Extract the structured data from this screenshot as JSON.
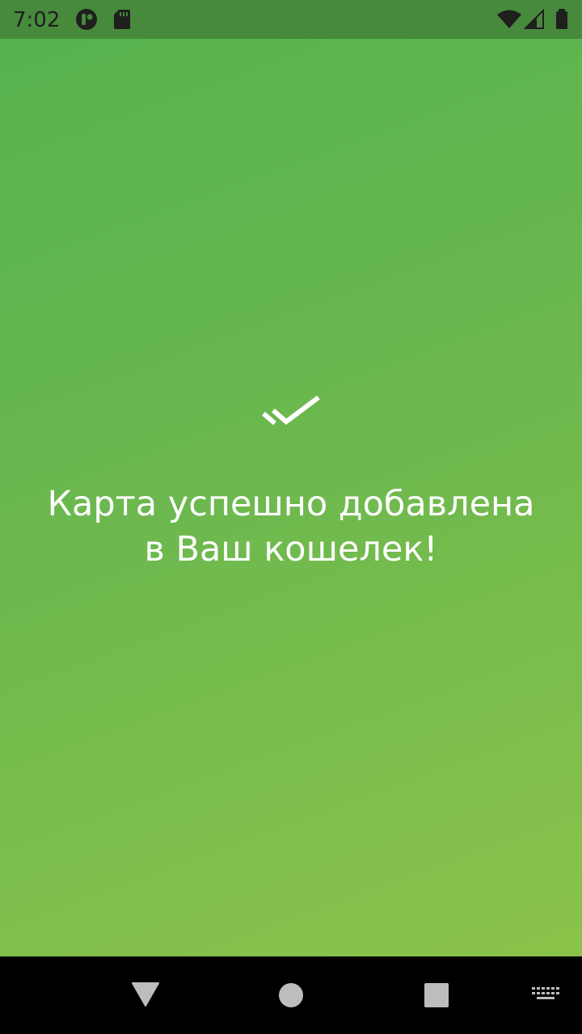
{
  "status_bar": {
    "time": "7:02",
    "icons": [
      "app-notification-icon",
      "sd-card-icon",
      "wifi-icon",
      "cell-signal-icon",
      "battery-icon"
    ]
  },
  "main": {
    "icon": "double-check-icon",
    "message_line1": "Карта успешно добавлена",
    "message_line2": "в Ваш кошелек!",
    "background_gradient": [
      "#55b24f",
      "#8bc34a"
    ],
    "text_color": "#ffffff"
  },
  "nav_bar": {
    "buttons": [
      "back-button",
      "home-button",
      "recents-button",
      "keyboard-switch-button"
    ]
  }
}
